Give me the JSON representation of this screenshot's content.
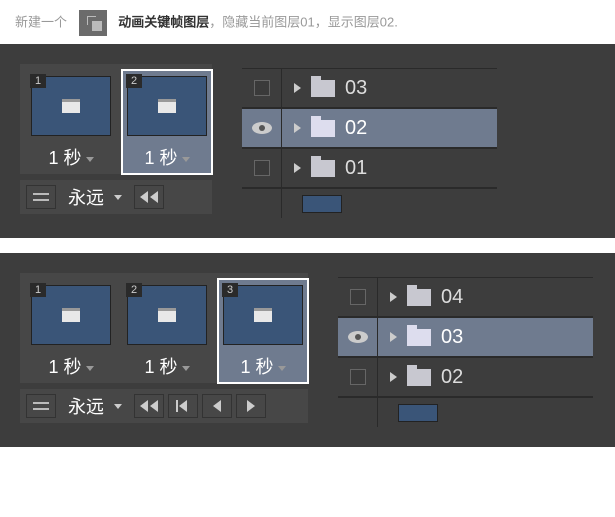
{
  "instruction": {
    "prefix": "新建一个",
    "bold": "动画关键帧图层",
    "suffix": "，隐藏当前图层01，显示图层02."
  },
  "panel1": {
    "frames": [
      {
        "num": "1",
        "dur": "1 秒",
        "sel": false
      },
      {
        "num": "2",
        "dur": "1 秒",
        "sel": true
      }
    ],
    "loop": "永远",
    "layers": [
      {
        "name": "03",
        "visible": false,
        "sel": false
      },
      {
        "name": "02",
        "visible": true,
        "sel": true
      },
      {
        "name": "01",
        "visible": false,
        "sel": false
      }
    ]
  },
  "panel2": {
    "frames": [
      {
        "num": "1",
        "dur": "1 秒",
        "sel": false
      },
      {
        "num": "2",
        "dur": "1 秒",
        "sel": false
      },
      {
        "num": "3",
        "dur": "1 秒",
        "sel": true
      }
    ],
    "loop": "永远",
    "layers": [
      {
        "name": "04",
        "visible": false,
        "sel": false
      },
      {
        "name": "03",
        "visible": true,
        "sel": true
      },
      {
        "name": "02",
        "visible": false,
        "sel": false
      }
    ]
  }
}
